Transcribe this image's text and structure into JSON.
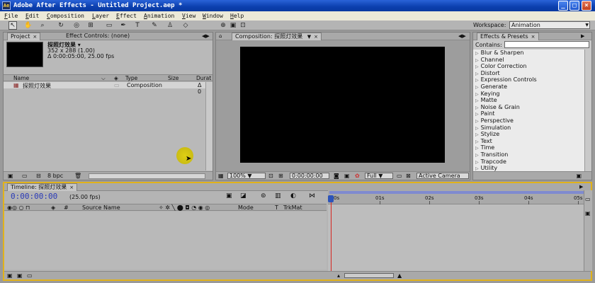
{
  "window": {
    "title": "Adobe After Effects - Untitled Project.aep *",
    "minimize": "_",
    "maximize": "□",
    "close": "×"
  },
  "menu": [
    "File",
    "Edit",
    "Composition",
    "Layer",
    "Effect",
    "Animation",
    "View",
    "Window",
    "Help"
  ],
  "toolbar": {
    "workspace_label": "Workspace:",
    "workspace_value": "Animation"
  },
  "project_panel": {
    "tab": "Project",
    "effect_controls_tab": "Effect Controls: (none)",
    "item_name": "探照灯效果",
    "item_size": "352 x 288 (1.00)",
    "item_duration": "Δ 0:00:05:00, 25.00 fps",
    "columns": [
      "Name",
      "Type",
      "Size",
      "Durat"
    ],
    "rows": [
      {
        "name": "探照灯效果",
        "type": "Composition",
        "duration": "Δ 0"
      }
    ],
    "bit_depth": "8 bpc"
  },
  "composition_panel": {
    "tab": "Composition: 探照灯效果",
    "zoom": "100%",
    "timecode": "0:00:00:00",
    "resolution": "Full",
    "camera": "Active Camera"
  },
  "effects_panel": {
    "tab": "Effects & Presets",
    "contains_label": "Contains:",
    "contains_value": "",
    "items": [
      "Blur & Sharpen",
      "Channel",
      "Color Correction",
      "Distort",
      "Expression Controls",
      "Generate",
      "Keying",
      "Matte",
      "Noise & Grain",
      "Paint",
      "Perspective",
      "Simulation",
      "Stylize",
      "Text",
      "Time",
      "Transition",
      "Trapcode",
      "Utility"
    ]
  },
  "timeline_panel": {
    "tab": "Timeline: 探照灯效果",
    "timecode": "0:00:00:00",
    "fps": "(25.00 fps)",
    "columns": {
      "source_name": "Source Name",
      "mode": "Mode",
      "t": "T",
      "trkmat": "TrkMat",
      "hash": "#"
    },
    "ruler": [
      "0s",
      "01s",
      "02s",
      "03s",
      "04s",
      "05s"
    ]
  }
}
